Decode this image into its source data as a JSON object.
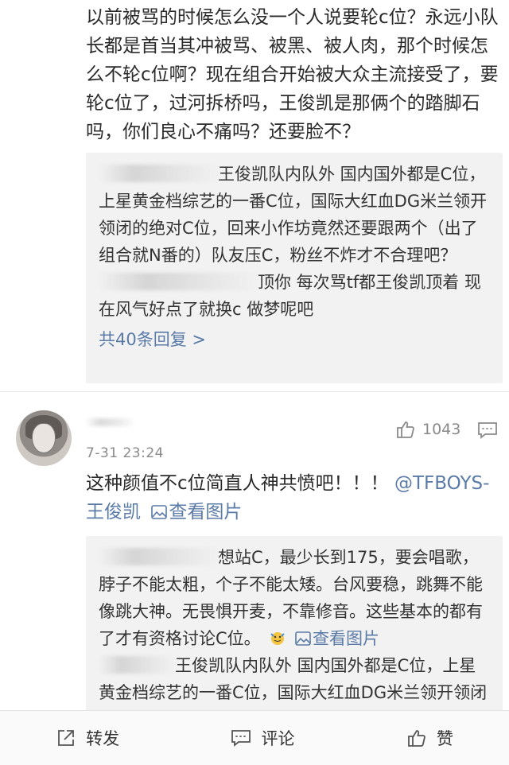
{
  "top_comment": {
    "text": "以前被骂的时候怎么没一个人说要轮c位？永远小队长都是首当其冲被骂、被黑、被人肉，那个时候怎么不轮c位啊？现在组合开始被大众主流接受了，要轮c位了，过河拆桥吗，王俊凯是那俩个的踏脚石吗，你们良心不痛吗？还要脸不？"
  },
  "reply_thread_1": {
    "reply_a": "王俊凯队内队外 国内国外都是C位，上星黄金档综艺的一番C位，国际大红血DG米兰领开领闭的绝对C位，回来小作坊竟然还要跟两个（出了组合就N番的）队友压C，粉丝不炸才不合理吧？",
    "reply_b": "顶你  每次骂tf都王俊凯顶着 现在风气好点了就换c 做梦呢吧",
    "more_replies": "共40条回复 >"
  },
  "comment_2": {
    "timestamp": "7-31 23:24",
    "like_count": "1043",
    "text_main": "这种颜值不c位简直人神共愤吧！！！",
    "mention": "@TFBOYS-王俊凯",
    "view_image": "查看图片"
  },
  "reply_thread_2": {
    "reply_a": "想站C，最少长到175，要会唱歌，脖子不能太粗，个子不能太矮。台风要稳，跳舞不能像跳大神。无畏惧开麦，不靠修音。这些基本的都有了才有资格讨论C位。",
    "reply_a_link": "查看图片",
    "reply_b": "王俊凯队内队外 国内国外都是C位，上星黄金档综艺的一番C位，国际大红血DG米兰领开领闭的绝对C位，回来小作坊竟然还要跟两个（出"
  },
  "bottom_bar": {
    "repost": "转发",
    "comment": "评论",
    "like": "赞"
  },
  "icons": [
    "thumbs-up-icon",
    "comment-bubble-icon",
    "image-icon",
    "emoji-icon",
    "share-icon"
  ],
  "colors": {
    "link": "#5a7ba8",
    "reply_bg": "#f2f2f2",
    "meta": "#8a8a8a"
  }
}
